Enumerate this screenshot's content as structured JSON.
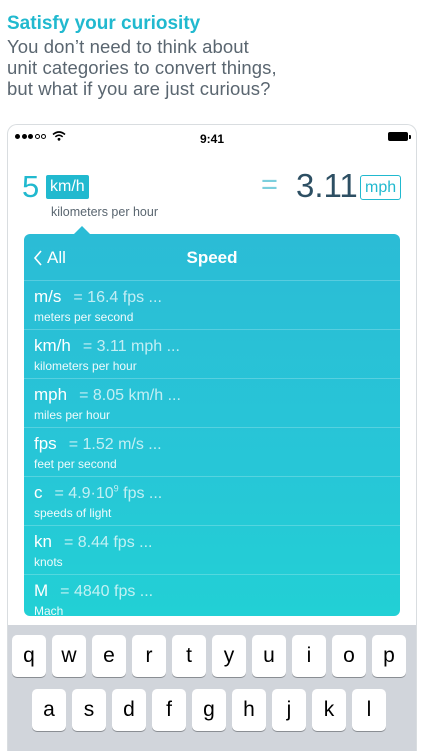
{
  "promo": {
    "title": "Satisfy your curiosity",
    "lines": [
      "You don’t need to think about",
      "unit categories to convert things,",
      "but what if you are just curious?"
    ]
  },
  "status_bar": {
    "time": "9:41"
  },
  "converter": {
    "input_value": "5",
    "from_unit": "km/h",
    "from_unit_name": "kilometers per hour",
    "equals": "=",
    "result_value": "3.11",
    "to_unit": "mph"
  },
  "panel": {
    "back_label": "All",
    "title": "Speed",
    "items": [
      {
        "unit": "m/s",
        "value": "= 16.4 fps ...",
        "name": "meters per second"
      },
      {
        "unit": "km/h",
        "value": "= 3.11 mph ...",
        "name": "kilometers per hour"
      },
      {
        "unit": "mph",
        "value": "= 8.05 km/h ...",
        "name": "miles per hour"
      },
      {
        "unit": "fps",
        "value": "= 1.52 m/s ...",
        "name": "feet per second"
      },
      {
        "unit": "c",
        "value_prefix": "= 4.9·10",
        "value_exp": "9",
        "value_suffix": " fps ...",
        "name": "speeds of light"
      },
      {
        "unit": "kn",
        "value": "= 8.44 fps ...",
        "name": "knots"
      },
      {
        "unit": "M",
        "value": "= 4840 fps ...",
        "name": "Mach"
      }
    ]
  },
  "keyboard": {
    "row1": [
      "q",
      "w",
      "e",
      "r",
      "t",
      "y",
      "u",
      "i",
      "o",
      "p"
    ],
    "row2": [
      "a",
      "s",
      "d",
      "f",
      "g",
      "h",
      "j",
      "k",
      "l"
    ]
  },
  "colors": {
    "accent": "#21b9cf",
    "panel_top": "#2bbcd6",
    "panel_bottom": "#22d0d5"
  }
}
